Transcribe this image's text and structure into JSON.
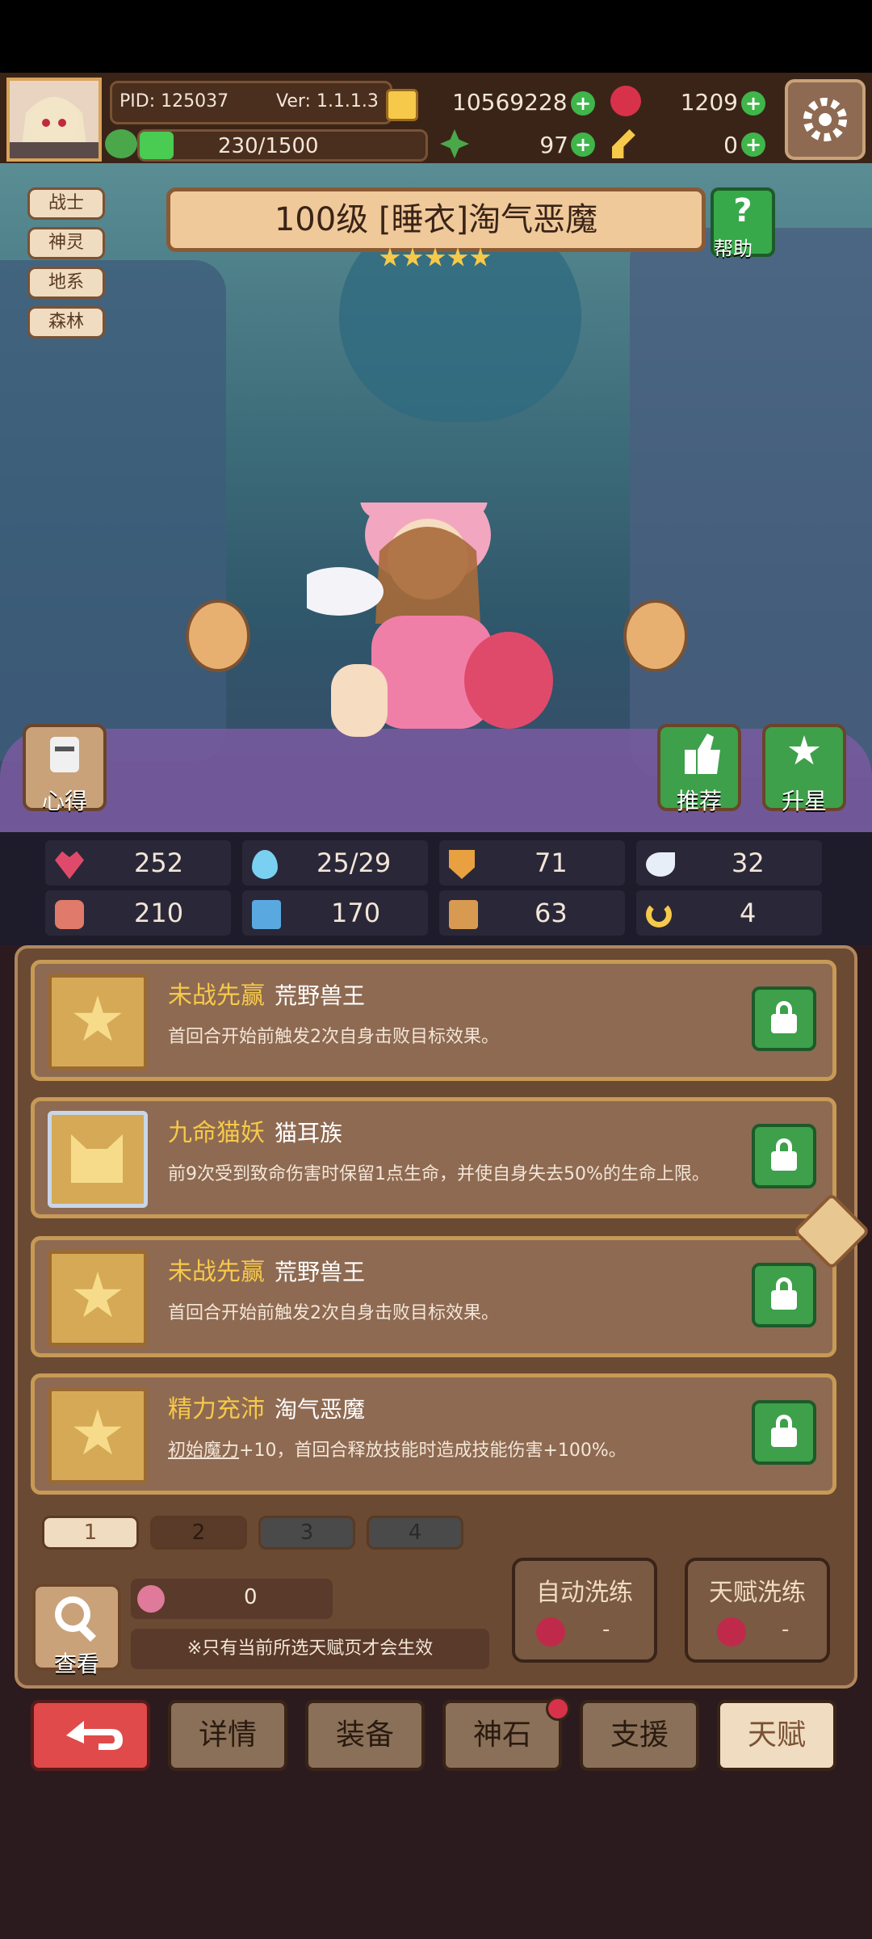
{
  "header": {
    "pid": "PID: 125037",
    "version": "Ver: 1.1.1.3",
    "gold": "10569228",
    "gems": "1209",
    "exp": "230/1500",
    "clover": "97",
    "key": "0"
  },
  "tags": [
    "战士",
    "神灵",
    "地系",
    "森林"
  ],
  "hero": {
    "title": "100级 [睡衣]淘气恶魔",
    "stars": 5,
    "help_label": "帮助",
    "notes_label": "心得",
    "recommend_label": "推荐",
    "upstar_label": "升星"
  },
  "stats": [
    {
      "icon": "heart-icon",
      "value": "252"
    },
    {
      "icon": "water-drop-icon",
      "value": "25/29"
    },
    {
      "icon": "shield-icon",
      "value": "71"
    },
    {
      "icon": "wing-icon",
      "value": "32"
    },
    {
      "icon": "fist-icon",
      "value": "210"
    },
    {
      "icon": "book-icon",
      "value": "170"
    },
    {
      "icon": "boot-icon",
      "value": "63"
    },
    {
      "icon": "horseshoe-icon",
      "value": "4"
    }
  ],
  "talents": [
    {
      "name": "未战先赢",
      "source": "荒野兽王",
      "desc": "首回合开始前触发2次自身击败目标效果。"
    },
    {
      "name": "九命猫妖",
      "source": "猫耳族",
      "desc": "前9次受到致命伤害时保留1点生命，并使自身失去50%的生命上限。"
    },
    {
      "name": "未战先赢",
      "source": "荒野兽王",
      "desc": "首回合开始前触发2次自身击败目标效果。"
    },
    {
      "name": "精力充沛",
      "source": "淘气恶魔",
      "desc_link": "初始魔力",
      "desc": "+10，首回合释放技能时造成技能伤害+100%。"
    }
  ],
  "pages": [
    "1",
    "2",
    "3",
    "4"
  ],
  "footer": {
    "view_label": "查看",
    "fruit_count": "0",
    "notice": "※只有当前所选天赋页才会生效",
    "auto_wash": "自动洗练",
    "auto_wash_cost": "-",
    "talent_wash": "天赋洗练",
    "talent_wash_cost": "-"
  },
  "nav": [
    "详情",
    "装备",
    "神石",
    "支援",
    "天赋"
  ]
}
